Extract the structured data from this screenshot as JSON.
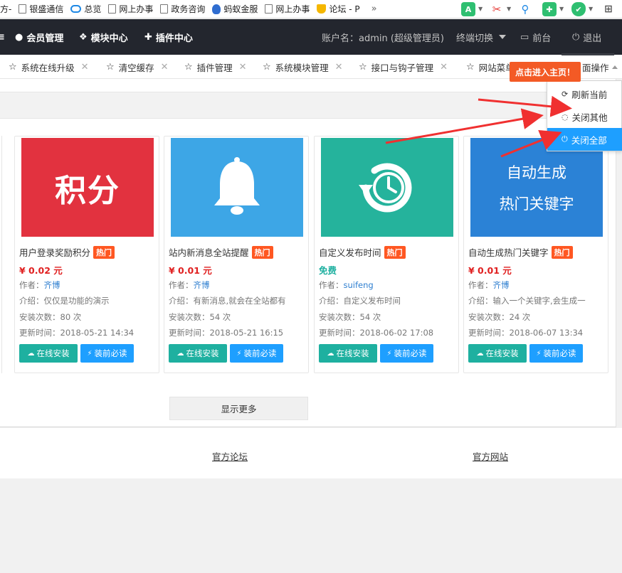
{
  "bookmarks": [
    {
      "label": "方-",
      "icon": "none"
    },
    {
      "label": "银盛通信",
      "icon": "page-icon"
    },
    {
      "label": "总览",
      "icon": "cloud-icon"
    },
    {
      "label": "网上办事",
      "icon": "page-icon"
    },
    {
      "label": "政务咨询",
      "icon": "page-icon"
    },
    {
      "label": "蚂蚁金服",
      "icon": "ant-icon"
    },
    {
      "label": "网上办事",
      "icon": "page-icon"
    },
    {
      "label": "论坛 - P",
      "icon": "trophy-icon"
    }
  ],
  "bookmarks_more": "»",
  "topnav": {
    "items": [
      {
        "label": "会员管理",
        "icon": "user-icon"
      },
      {
        "label": "模块中心",
        "icon": "cubes-icon"
      },
      {
        "label": "插件中心",
        "icon": "plugin-icon"
      }
    ],
    "account": "账户名：admin (超级管理员)",
    "terminal_switch": "终端切换",
    "frontend": "前台",
    "logout": "退出"
  },
  "tabs": [
    {
      "label": "系统在线升级"
    },
    {
      "label": "清空缓存"
    },
    {
      "label": "插件管理"
    },
    {
      "label": "系统模块管理"
    },
    {
      "label": "接口与钩子管理"
    },
    {
      "label": "网站菜单管理"
    }
  ],
  "page_op_label": "页面操作",
  "page_op_partial": "面操作",
  "annotation": "点击进入主页！",
  "dropdown": [
    {
      "label": "刷新当前",
      "icon": "refresh-icon"
    },
    {
      "label": "关闭其他",
      "icon": "close-other-icon"
    },
    {
      "label": "关闭全部",
      "icon": "power-icon"
    }
  ],
  "cards": [
    {
      "title": "用户登录奖励积分",
      "hot": "热门",
      "price": "¥ 0.02 元",
      "free": false,
      "author_label": "作者：",
      "author": "齐博",
      "intro": "介绍：仅仅是功能的演示",
      "installs": "安装次数：80 次",
      "updated": "更新时间：2018-05-21 14:34",
      "install_btn": "在线安装",
      "read_btn": "装前必读",
      "thumb_text": "积分",
      "thumb_color": "#e2323f"
    },
    {
      "title": "站内新消息全站提醒",
      "hot": "热门",
      "price": "¥ 0.01 元",
      "free": false,
      "author_label": "作者：",
      "author": "齐博",
      "intro": "介绍：有新消息,就会在全站都有",
      "installs": "安装次数：54 次",
      "updated": "更新时间：2018-05-21 16:15",
      "install_btn": "在线安装",
      "read_btn": "装前必读",
      "thumb_text": "",
      "thumb_color": "#3da6e6"
    },
    {
      "title": "自定义发布时间",
      "hot": "热门",
      "price": "免费",
      "free": true,
      "author_label": "作者：",
      "author": "suifeng",
      "intro": "介绍：自定义发布时间",
      "installs": "安装次数：54 次",
      "updated": "更新时间：2018-06-02 17:08",
      "install_btn": "在线安装",
      "read_btn": "装前必读",
      "thumb_text": "",
      "thumb_color": "#25b39c"
    },
    {
      "title": "自动生成热门关键字",
      "hot": "热门",
      "price": "¥ 0.01 元",
      "free": false,
      "author_label": "作者：",
      "author": "齐博",
      "intro": "介绍：输入一个关键字,会生成一",
      "installs": "安装次数：24 次",
      "updated": "更新时间：2018-06-07 13:34",
      "install_btn": "在线安装",
      "read_btn": "装前必读",
      "thumb_text": "自动生成",
      "thumb_text2": "热门关键字",
      "thumb_color": "#2b82d6"
    }
  ],
  "show_more": "显示更多",
  "footer": {
    "forum": "官方论坛",
    "site": "官方网站"
  },
  "colors": {
    "nav_bg": "#23262e",
    "accent": "#1e9fff",
    "install": "#1eb0a0",
    "hot": "#ff5722",
    "price": "#e02020",
    "annotation": "#f35a25"
  }
}
